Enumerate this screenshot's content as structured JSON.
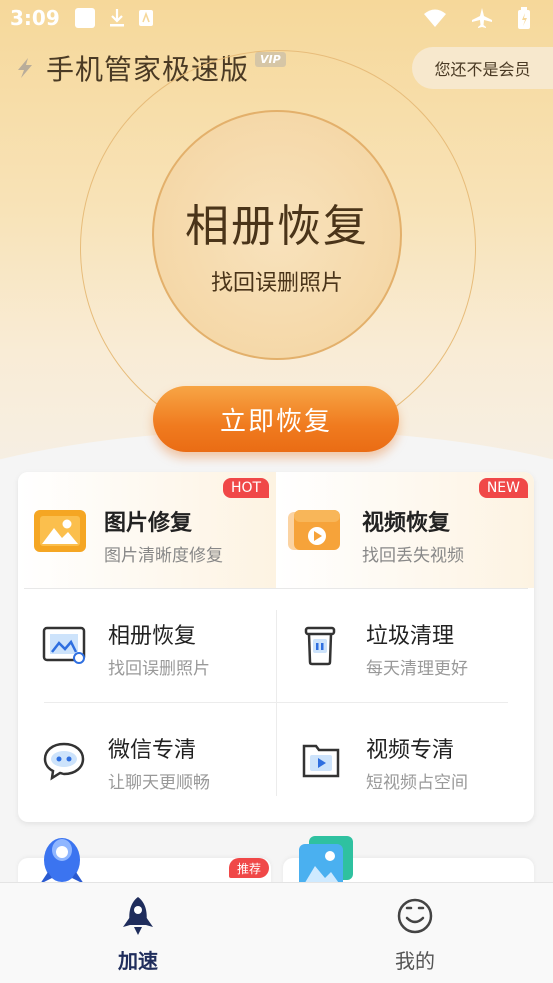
{
  "status_bar": {
    "time": "3:09"
  },
  "header": {
    "app_title": "手机管家极速版",
    "vip_badge": "VIP",
    "member_status": "您还不是会员"
  },
  "hero": {
    "title": "相册恢复",
    "subtitle": "找回误删照片",
    "cta_label": "立即恢复"
  },
  "featured": [
    {
      "title": "图片修复",
      "subtitle": "图片清晰度修复",
      "tag": "HOT",
      "icon": "image-repair-icon"
    },
    {
      "title": "视频恢复",
      "subtitle": "找回丢失视频",
      "tag": "NEW",
      "icon": "video-recover-icon"
    }
  ],
  "tools": [
    {
      "title": "相册恢复",
      "subtitle": "找回误删照片",
      "icon": "album-icon"
    },
    {
      "title": "垃圾清理",
      "subtitle": "每天清理更好",
      "icon": "trash-icon"
    },
    {
      "title": "微信专清",
      "subtitle": "让聊天更顺畅",
      "icon": "chat-icon"
    },
    {
      "title": "视频专清",
      "subtitle": "短视频占空间",
      "icon": "video-folder-icon"
    }
  ],
  "promo": {
    "recommend_tag": "推荐"
  },
  "bottom_nav": [
    {
      "label": "加速",
      "icon": "rocket-icon",
      "active": true
    },
    {
      "label": "我的",
      "icon": "smile-icon",
      "active": false
    }
  ],
  "colors": {
    "accent_orange": "#f07b1f",
    "tag_red": "#f04848",
    "nav_active": "#1f2d5c"
  }
}
